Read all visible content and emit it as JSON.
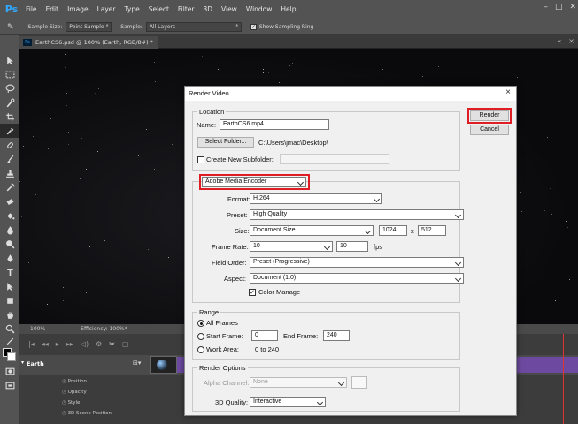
{
  "app": {
    "logo": "Ps"
  },
  "menu": [
    "File",
    "Edit",
    "Image",
    "Layer",
    "Type",
    "Select",
    "Filter",
    "3D",
    "View",
    "Window",
    "Help"
  ],
  "options_bar": {
    "sample_size_label": "Sample Size:",
    "sample_size_value": "Point Sample",
    "sample_label": "Sample:",
    "sample_value": "All Layers",
    "show_ring_label": "Show Sampling Ring"
  },
  "document_tab": "EarthCS6.psd @ 100% (Earth, RGB/8#) *",
  "status_bar": {
    "zoom": "100%",
    "efficiency": "Efficiency: 100%*"
  },
  "timeline": {
    "layer_name": "Earth",
    "properties": [
      "Position",
      "Opacity",
      "Style",
      "3D Scene Position"
    ]
  },
  "dialog": {
    "title": "Render Video",
    "render_button": "Render",
    "cancel_button": "Cancel",
    "location": {
      "group_title": "Location",
      "name_label": "Name:",
      "name_value": "EarthCS6.mp4",
      "select_folder_button": "Select Folder...",
      "folder_path": "C:\\Users\\jmac\\Desktop\\",
      "subfolder_label": "Create New Subfolder:",
      "subfolder_checked": false
    },
    "encoder": {
      "engine": "Adobe Media Encoder",
      "format_label": "Format:",
      "format_value": "H.264",
      "preset_label": "Preset:",
      "preset_value": "High Quality",
      "size_label": "Size:",
      "size_value": "Document Size",
      "width": "1024",
      "x_sep": "x",
      "height": "512",
      "frame_rate_label": "Frame Rate:",
      "frame_rate_value": "10",
      "fps_value": "10",
      "fps_label": "fps",
      "field_order_label": "Field Order:",
      "field_order_value": "Preset (Progressive)",
      "aspect_label": "Aspect:",
      "aspect_value": "Document (1.0)",
      "color_manage_label": "Color Manage",
      "color_manage_checked": true
    },
    "range": {
      "group_title": "Range",
      "all_frames_label": "All Frames",
      "start_frame_label": "Start Frame:",
      "start_frame_value": "0",
      "end_frame_label": "End Frame:",
      "end_frame_value": "240",
      "work_area_label": "Work Area:",
      "work_area_value": "0 to 240",
      "selected": "All Frames"
    },
    "render_options": {
      "group_title": "Render Options",
      "alpha_label": "Alpha Channel:",
      "alpha_value": "None",
      "quality_label": "3D Quality:",
      "quality_value": "Interactive"
    }
  },
  "colors": {
    "highlight": "#e01c24",
    "track": "#6d4a9f",
    "ps_blue": "#31a8ff"
  }
}
